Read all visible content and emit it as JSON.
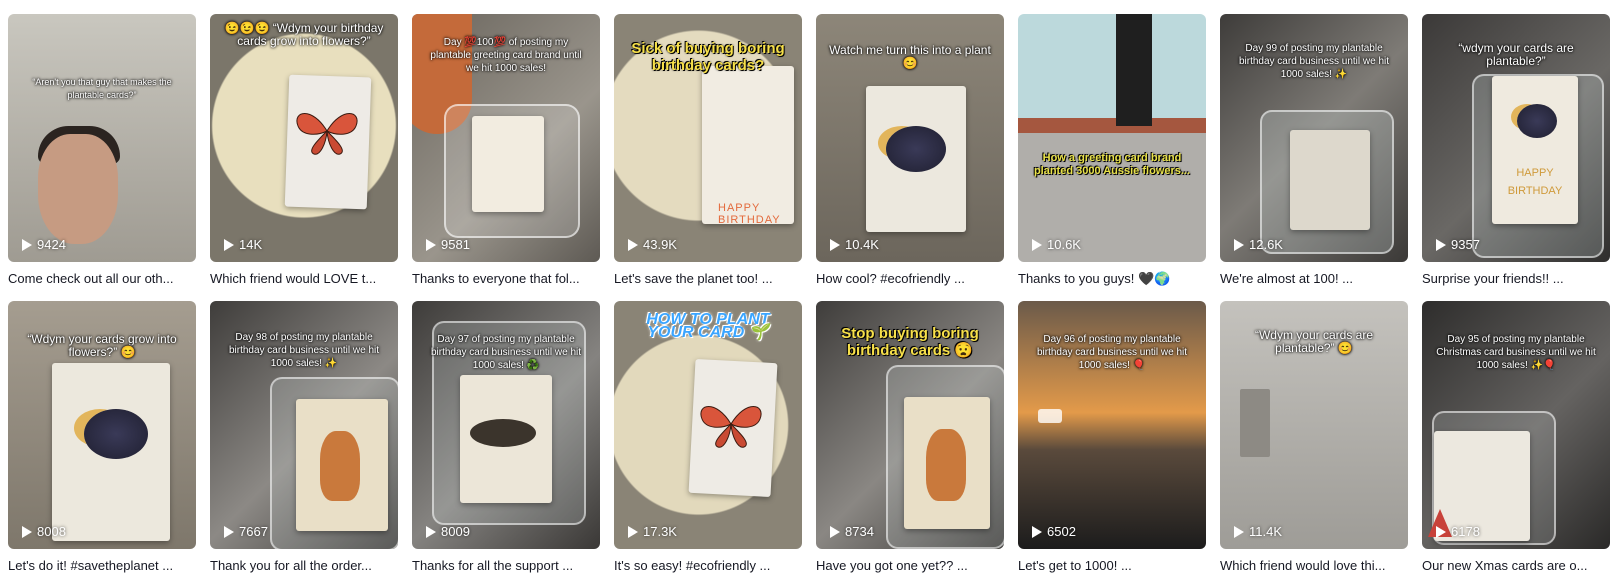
{
  "videos": [
    {
      "plays": "9424",
      "caption": "Come check out all our oth...",
      "overlay": "“Aren't you that guy that makes the plantable cards?”",
      "bg": "#b8b6ae"
    },
    {
      "plays": "14K",
      "caption": "Which friend would LOVE t...",
      "overlay": "😉😉😉 “Wdym your birthday cards grow into flowers?”",
      "bg": "#d6cfb8"
    },
    {
      "plays": "9581",
      "caption": "Thanks to everyone that fol...",
      "overlay": "Day 💯100💯 of posting my plantable greeting card brand until we hit 1000 sales!",
      "bg": "#7a7670"
    },
    {
      "plays": "43.9K",
      "caption": "Let's save the planet too! ...",
      "overlay": "Sick of buying boring birthday cards?",
      "bg": "#cfc6ae"
    },
    {
      "plays": "10.4K",
      "caption": "How cool? #ecofriendly ...",
      "overlay": "Watch me turn this into a plant 😊",
      "bg": "#8b8478"
    },
    {
      "plays": "10.6K",
      "caption": "Thanks to you guys! 🖤🌍",
      "overlay": "How a greeting card brand planted 3000 Aussie flowers...",
      "bg": "#9a9a96"
    },
    {
      "plays": "12.6K",
      "caption": "We're almost at 100! ...",
      "overlay": "Day 99 of posting my plantable birthday card business until we hit 1000 sales! ✨",
      "bg": "#4e4c4a"
    },
    {
      "plays": "9357",
      "caption": "Surprise your friends!! ...",
      "overlay": "“wdym your cards are plantable?”",
      "bg": "#5a5856"
    },
    {
      "plays": "8008",
      "caption": "Let's do it! #savetheplanet ...",
      "overlay": "“Wdym your cards grow into flowers?” 😊",
      "bg": "#9c9488"
    },
    {
      "plays": "7667",
      "caption": "Thank you for all the order...",
      "overlay": "Day 98 of posting my plantable birthday card business until we hit 1000 sales! ✨",
      "bg": "#5c5a57"
    },
    {
      "plays": "8009",
      "caption": "Thanks for all the support ...",
      "overlay": "Day 97 of posting my plantable birthday card business until we hit 1000 sales! ♻️",
      "bg": "#55524f"
    },
    {
      "plays": "17.3K",
      "caption": "It's so easy! #ecofriendly ...",
      "overlay": "HOW TO PLANT YOUR CARD 🌱",
      "bg": "#cdc5ae"
    },
    {
      "plays": "8734",
      "caption": "Have you got one yet?? ...",
      "overlay": "Stop buying boring birthday cards 😧",
      "bg": "#5b5954"
    },
    {
      "plays": "6502",
      "caption": "Let's get to 1000! ...",
      "overlay": "Day 96 of posting my plantable birthday card business until we hit 1000 sales! 🎈",
      "bg": "#3a3028"
    },
    {
      "plays": "11.4K",
      "caption": "Which friend would love thi...",
      "overlay": "“Wdym your cards are plantable?” 😊",
      "bg": "#b9b7b2"
    },
    {
      "plays": "6178",
      "caption": "Our new Xmas cards are o...",
      "overlay": "Day 95 of posting my plantable Christmas card business until we hit 1000 sales! ✨🎈",
      "bg": "#3b3a39"
    }
  ]
}
